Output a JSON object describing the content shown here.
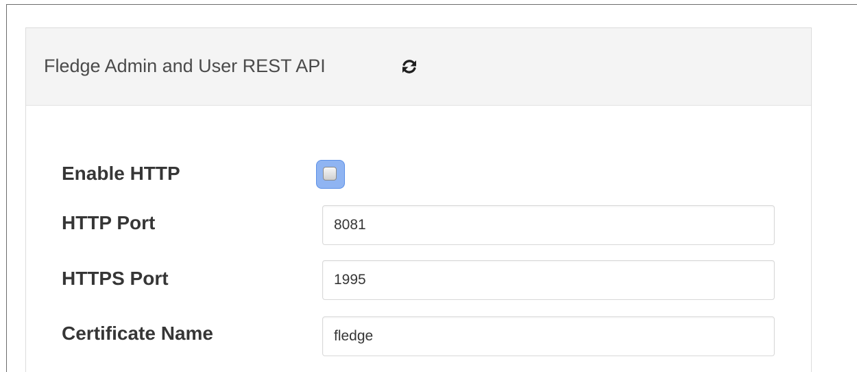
{
  "panel": {
    "title": "Fledge Admin and User REST API",
    "refresh_icon": "refresh-icon"
  },
  "fields": {
    "enable_http": {
      "label": "Enable HTTP",
      "checked": false
    },
    "http_port": {
      "label": "HTTP Port",
      "value": "8081"
    },
    "https_port": {
      "label": "HTTPS Port",
      "value": "1995"
    },
    "certificate_name": {
      "label": "Certificate Name",
      "value": "fledge"
    }
  },
  "colors": {
    "header_bg": "#f4f4f4",
    "checkbox_focus": "#8fb4f2",
    "label_text": "#363636"
  }
}
